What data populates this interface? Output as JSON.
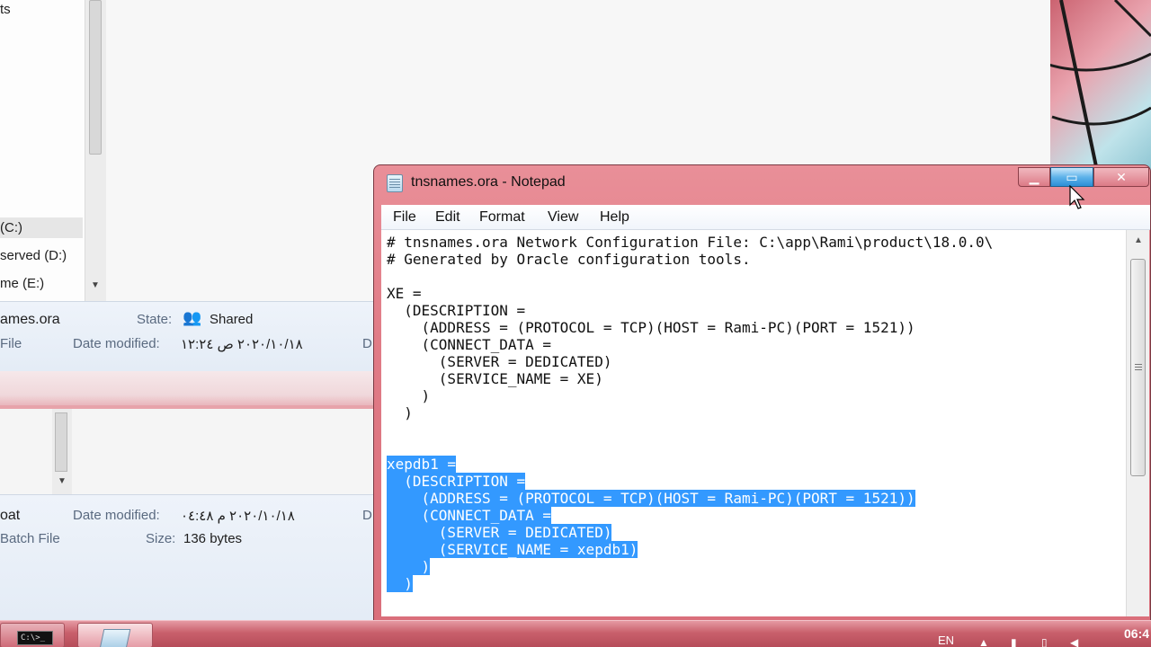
{
  "explorer_top": {
    "nav_items": [
      {
        "label": "ts"
      },
      {
        "label": "(C:)"
      },
      {
        "label": "served (D:)"
      },
      {
        "label": "me (E:)"
      }
    ],
    "details": {
      "filename": "ames.ora",
      "type": "File",
      "state_label": "State:",
      "state_value": "Shared",
      "date_label": "Date modified:",
      "date_value": "۲۰۲۰/۱۰/۱۸ ص ۱۲:۲٤",
      "trunc": "D"
    }
  },
  "explorer_bottom": {
    "details": {
      "filename": "oat",
      "type": "Batch File",
      "date_label": "Date modified:",
      "date_value": "۲۰۲۰/۱۰/۱۸ م ۰٤:٤٨",
      "size_label": "Size:",
      "size_value": "136 bytes",
      "trunc": "D"
    }
  },
  "notepad": {
    "title": "tnsnames.ora - Notepad",
    "menu": [
      "File",
      "Edit",
      "Format",
      "View",
      "Help"
    ],
    "lines": [
      "# tnsnames.ora Network Configuration File: C:\\app\\Rami\\product\\18.0.0\\",
      "# Generated by Oracle configuration tools.",
      "",
      "XE =",
      "  (DESCRIPTION =",
      "    (ADDRESS = (PROTOCOL = TCP)(HOST = Rami-PC)(PORT = 1521))",
      "    (CONNECT_DATA =",
      "      (SERVER = DEDICATED)",
      "      (SERVICE_NAME = XE)",
      "    )",
      "  )",
      "",
      "",
      "xepdb1 =",
      "  (DESCRIPTION =",
      "    (ADDRESS = (PROTOCOL = TCP)(HOST = Rami-PC)(PORT = 1521))",
      "    (CONNECT_DATA =",
      "      (SERVER = DEDICATED)",
      "      (SERVICE_NAME = xepdb1)",
      "    )",
      "  )"
    ],
    "selected_from_line": 13
  },
  "taskbar": {
    "cmd_icon_text": "C:\\>_",
    "language": "EN",
    "clock": "06:4"
  },
  "colors": {
    "selection": "#3399ff",
    "titlebar": "#e07b86",
    "taskbar": "#c9606c"
  }
}
